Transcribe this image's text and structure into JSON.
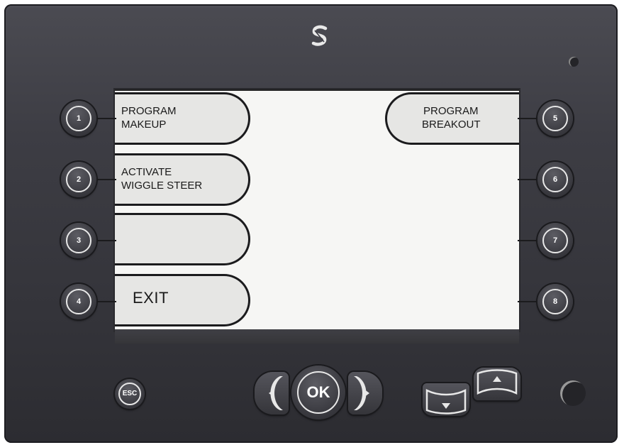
{
  "softkeys": {
    "left": [
      {
        "number": "1",
        "line1": "PROGRAM",
        "line2": "MAKEUP"
      },
      {
        "number": "2",
        "line1": "ACTIVATE",
        "line2": "WIGGLE STEER"
      },
      {
        "number": "3",
        "line1": "",
        "line2": ""
      },
      {
        "number": "4",
        "line1": "EXIT",
        "line2": ""
      }
    ],
    "right": [
      {
        "number": "5",
        "line1": "PROGRAM",
        "line2": "BREAKOUT"
      },
      {
        "number": "6",
        "line1": "",
        "line2": ""
      },
      {
        "number": "7",
        "line1": "",
        "line2": ""
      },
      {
        "number": "8",
        "line1": "",
        "line2": ""
      }
    ]
  },
  "controls": {
    "esc_label": "ESC",
    "ok_label": "OK"
  },
  "icons": {
    "logo": "brand-s-logo-icon",
    "left": "left-arrow-icon",
    "right": "right-arrow-icon",
    "down": "down-arrow-icon",
    "up": "up-arrow-icon"
  },
  "colors": {
    "bezel": "#3d3d44",
    "screen": "#f6f6f4",
    "softkey": "#e6e6e4",
    "button_ring": "#e8e8e8"
  }
}
